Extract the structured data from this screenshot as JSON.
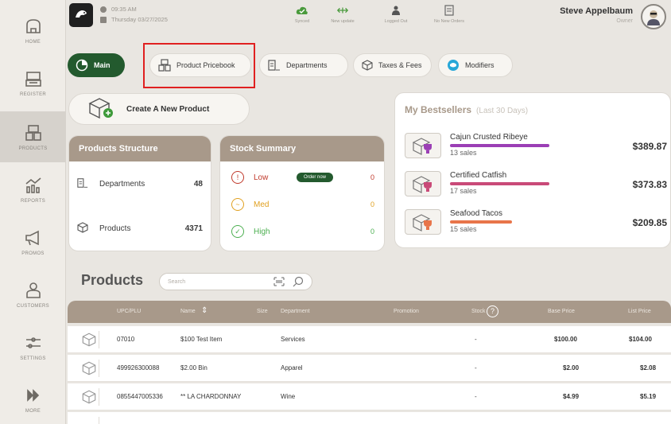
{
  "sidebar": {
    "items": [
      {
        "label": "HOME",
        "icon": "home-icon"
      },
      {
        "label": "REGISTER",
        "icon": "register-icon"
      },
      {
        "label": "PRODUCTS",
        "icon": "products-icon",
        "active": true
      },
      {
        "label": "REPORTS",
        "icon": "reports-icon"
      },
      {
        "label": "PROMOS",
        "icon": "promos-icon"
      },
      {
        "label": "CUSTOMERS",
        "icon": "customers-icon"
      },
      {
        "label": "SETTINGS",
        "icon": "settings-icon"
      },
      {
        "label": "MORE",
        "icon": "more-icon"
      }
    ]
  },
  "header": {
    "time": "09:35 AM",
    "date": "Thursday 03/27/2025",
    "statuses": [
      {
        "label": "Synced",
        "icon": "synced-icon"
      },
      {
        "label": "New update",
        "icon": "update-icon"
      },
      {
        "label": "Logged Out",
        "icon": "user-icon"
      },
      {
        "label": "No New Orders",
        "icon": "orders-icon"
      }
    ],
    "user_name": "Steve Appelbaum",
    "user_role": "Owner"
  },
  "tabs": [
    {
      "label": "Main",
      "icon": "main-icon"
    },
    {
      "label": "Product Pricebook",
      "icon": "pricebook-icon"
    },
    {
      "label": "Departments",
      "icon": "departments-icon"
    },
    {
      "label": "Taxes & Fees",
      "icon": "taxes-icon"
    },
    {
      "label": "Modifiers",
      "icon": "modifiers-icon"
    }
  ],
  "create_button": "Create A New Product",
  "products_structure": {
    "title": "Products Structure",
    "rows": [
      {
        "label": "Departments",
        "value": "48"
      },
      {
        "label": "Products",
        "value": "4371"
      }
    ]
  },
  "stock_summary": {
    "title": "Stock Summary",
    "order_now": "Order now",
    "rows": [
      {
        "label": "Low",
        "value": "0",
        "color": "#c0392b",
        "symbol": "!"
      },
      {
        "label": "Med",
        "value": "0",
        "color": "#e0a020",
        "symbol": "~"
      },
      {
        "label": "High",
        "value": "0",
        "color": "#4caf50",
        "symbol": "✓"
      }
    ]
  },
  "bestsellers": {
    "title": "My Bestsellers",
    "period": "(Last 30 Days)",
    "items": [
      {
        "name": "Cajun Crusted Ribeye",
        "sales": "13 sales",
        "price": "$389.87",
        "bar_color": "#9b3fb5",
        "level": 0.96
      },
      {
        "name": "Certified Catfish",
        "sales": "17 sales",
        "price": "$373.83",
        "bar_color": "#c94a78",
        "level": 0.96
      },
      {
        "name": "Seafood Tacos",
        "sales": "15 sales",
        "price": "$209.85",
        "bar_color": "#e8754a",
        "level": 0.6
      }
    ]
  },
  "products": {
    "title": "Products",
    "search_placeholder": "Search",
    "columns": [
      "UPC/PLU",
      "Name",
      "Size",
      "Department",
      "Promotion",
      "Stock",
      "Base Price",
      "List Price"
    ],
    "rows": [
      {
        "upc": "07010",
        "name": "$100 Test Item",
        "dept": "Services",
        "promo": "-",
        "base": "$100.00",
        "list": "$104.00"
      },
      {
        "upc": "499926300088",
        "name": "$2.00 Bin",
        "dept": "Apparel",
        "promo": "-",
        "base": "$2.00",
        "list": "$2.08"
      },
      {
        "upc": "0855447005336",
        "name": "** LA CHARDONNAY",
        "dept": "Wine",
        "promo": "-",
        "base": "$4.99",
        "list": "$5.19"
      }
    ]
  }
}
